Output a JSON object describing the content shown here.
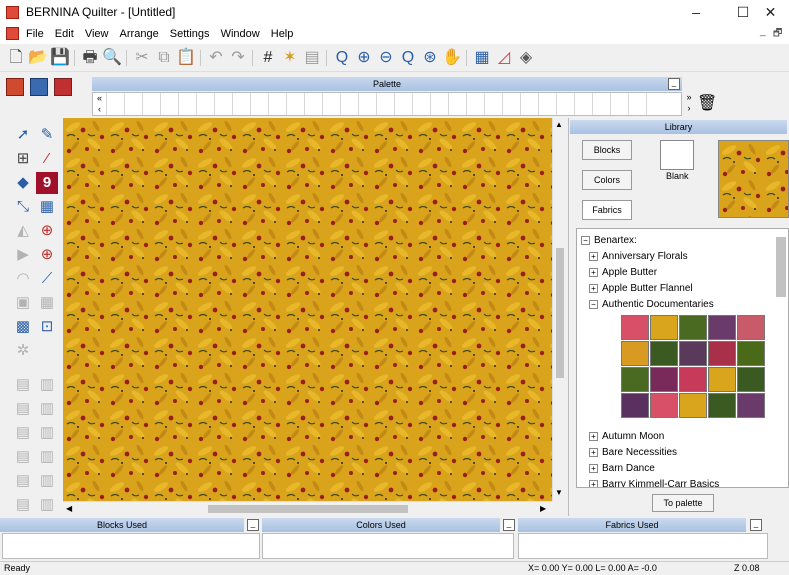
{
  "window": {
    "title": "BERNINA Quilter - [Untitled]",
    "min": "–",
    "max": "☐",
    "close": "✕"
  },
  "menu": {
    "items": [
      "File",
      "Edit",
      "View",
      "Arrange",
      "Settings",
      "Window",
      "Help"
    ],
    "mdi_min": "_",
    "mdi_restore": "🗗"
  },
  "palette": {
    "title": "Palette",
    "min_label": "_"
  },
  "library": {
    "title": "Library",
    "buttons": {
      "blocks": "Blocks",
      "colors": "Colors",
      "fabrics": "Fabrics"
    },
    "blank_label": "Blank",
    "tree": {
      "root": "Benartex:",
      "items": [
        "Anniversary Florals",
        "Apple Butter",
        "Apple Butter Flannel",
        "Authentic Documentaries",
        "Autumn Moon",
        "Bare Necessities",
        "Barn Dance",
        "Barry Kimmell-Carr Basics"
      ]
    },
    "to_palette": "To palette"
  },
  "panels": {
    "blocks": "Blocks Used",
    "colors": "Colors Used",
    "fabrics": "Fabrics Used"
  },
  "status": {
    "ready": "Ready",
    "coords": "X=  0.00 Y=   0.00 L=   0.00 A=  -0.0",
    "zoom": "Z 0.08"
  },
  "colors": {
    "fabric_base": "#d9a41c",
    "fabric_leaf": "#e8b82a",
    "fabric_berry": "#9a1f18",
    "header_blue": "#b8cde8"
  }
}
